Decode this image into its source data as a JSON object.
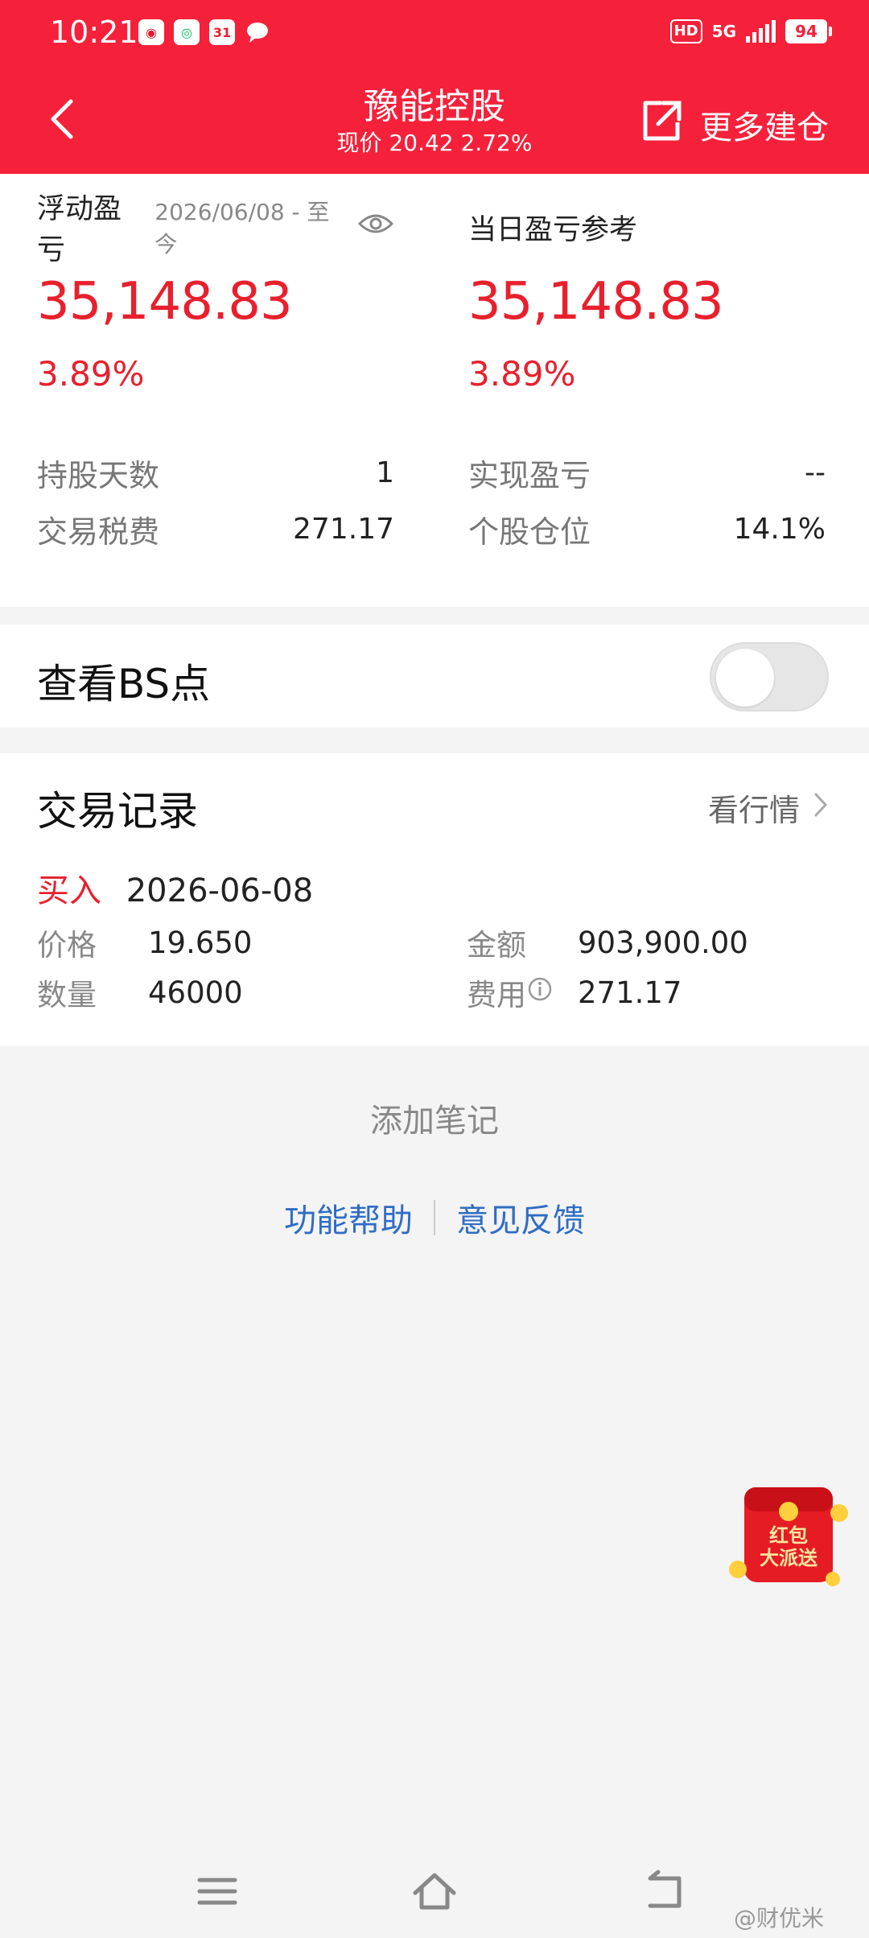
{
  "status_bar": {
    "time": "10:21",
    "notification_icons": [
      "weibo-icon",
      "wechat-mini-icon",
      "calendar-icon",
      "message-icon"
    ],
    "calendar_badge": "31",
    "hd": "HD",
    "network": "5G",
    "battery": "94"
  },
  "header": {
    "title": "豫能控股",
    "subtitle": "现价 20.42 2.72%",
    "more_label": "更多建仓"
  },
  "summary": {
    "float_label": "浮动盈亏",
    "float_date": "2026/06/08 - 至今",
    "float_value": "35,148.83",
    "float_pct": "3.89%",
    "daily_label": "当日盈亏参考",
    "daily_value": "35,148.83",
    "daily_pct": "3.89%",
    "hold_days_label": "持股天数",
    "hold_days_value": "1",
    "fee_label": "交易税费",
    "fee_value": "271.17",
    "realized_label": "实现盈亏",
    "realized_value": "--",
    "position_label": "个股仓位",
    "position_value": "14.1%"
  },
  "bs_toggle": {
    "label": "查看BS点",
    "enabled": false
  },
  "records": {
    "title": "交易记录",
    "view_quote": "看行情",
    "entry": {
      "action": "买入",
      "date": "2026-06-08",
      "price_label": "价格",
      "price": "19.650",
      "qty_label": "数量",
      "qty": "46000",
      "amount_label": "金额",
      "amount": "903,900.00",
      "cost_label": "费用",
      "cost": "271.17"
    }
  },
  "add_note": "添加笔记",
  "footer_links": {
    "help": "功能帮助",
    "feedback": "意见反馈"
  },
  "promo": {
    "line1": "红包",
    "line2": "大派送"
  },
  "watermark": "@财优米",
  "colors": {
    "brand_red": "#f5213a",
    "profit_red": "#e8202d",
    "link_blue": "#2f6dc4"
  }
}
